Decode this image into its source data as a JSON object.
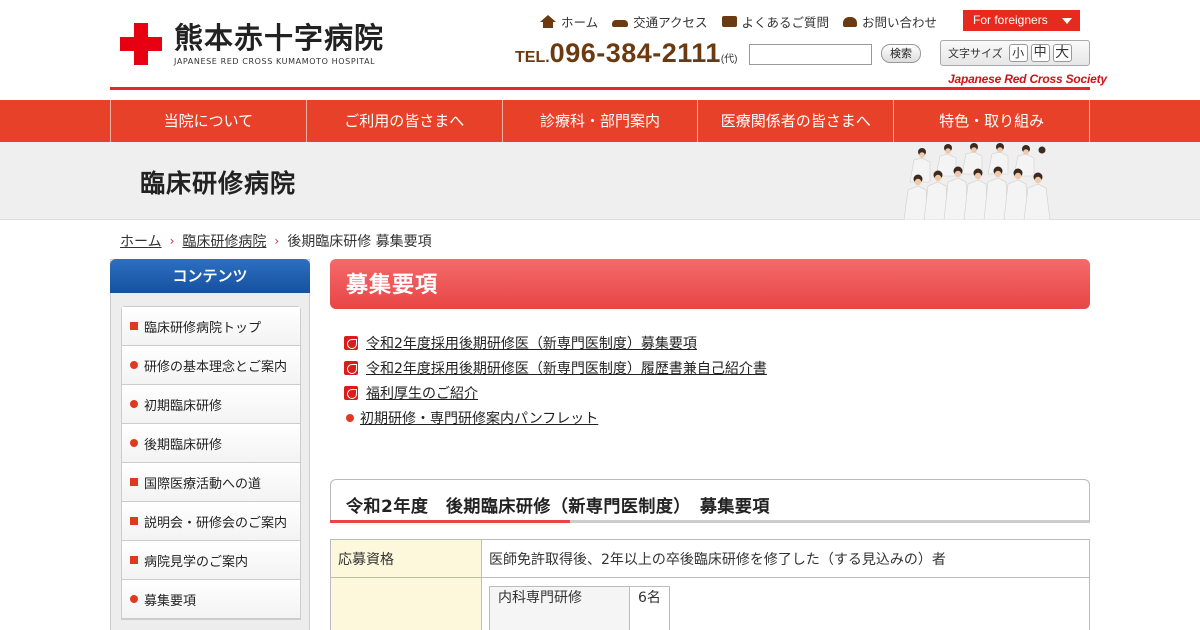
{
  "header": {
    "logo_title": "熊本赤十字病院",
    "logo_sub": "JAPANESE RED CROSS KUMAMOTO HOSPITAL",
    "util_nav": [
      {
        "label": "ホーム",
        "icon": "home-icon"
      },
      {
        "label": "交通アクセス",
        "icon": "car-icon"
      },
      {
        "label": "よくあるご質問",
        "icon": "faq-icon"
      },
      {
        "label": "お問い合わせ",
        "icon": "phone-icon"
      }
    ],
    "foreign_label": "For foreigners",
    "tel_prefix": "TEL.",
    "tel_number": "096-384-2111",
    "tel_suffix": "(代)",
    "search_placeholder": "",
    "search_button": "検索",
    "fontsize_label": "文字サイズ",
    "fontsize_small": "小",
    "fontsize_mid": "中",
    "fontsize_large": "大",
    "society": "Japanese Red Cross Society"
  },
  "gnav": [
    "当院について",
    "ご利用の皆さまへ",
    "診療科・部門案内",
    "医療関係者の皆さまへ",
    "特色・取り組み"
  ],
  "band": {
    "title": "臨床研修病院"
  },
  "breadcrumb": [
    {
      "label": "ホーム"
    },
    {
      "label": "臨床研修病院"
    },
    {
      "label": "後期臨床研修 募集要項"
    }
  ],
  "sidebar": {
    "heading": "コンテンツ",
    "items": [
      {
        "label": "臨床研修病院トップ",
        "mark": "square"
      },
      {
        "label": "研修の基本理念とご案内",
        "mark": "dot"
      },
      {
        "label": "初期臨床研修",
        "mark": "dot"
      },
      {
        "label": "後期臨床研修",
        "mark": "dot"
      },
      {
        "label": "国際医療活動への道",
        "mark": "square"
      },
      {
        "label": "説明会・研修会のご案内",
        "mark": "square"
      },
      {
        "label": "病院見学のご案内",
        "mark": "square"
      },
      {
        "label": "募集要項",
        "mark": "dot"
      }
    ]
  },
  "main": {
    "heading": "募集要項",
    "links": [
      {
        "label": "令和2年度採用後期研修医（新専門医制度）募集要項",
        "icon": "pdf-icon"
      },
      {
        "label": "令和2年度採用後期研修医（新専門医制度）履歴書兼自己紹介書",
        "icon": "pdf-icon"
      },
      {
        "label": "福利厚生のご紹介",
        "icon": "pdf-icon"
      },
      {
        "label": "初期研修・専門研修案内パンフレット",
        "icon": "dot-icon"
      }
    ],
    "section_title": "令和2年度　後期臨床研修（新専門医制度）　募集要項",
    "table": {
      "row1_label": "応募資格",
      "row1_value": "医師免許取得後、2年以上の卒後臨床研修を修了した（する見込みの）者",
      "inner_name": "内科専門研修",
      "inner_count": "6名"
    }
  },
  "colors": {
    "brand_red": "#e8412a",
    "sidebar_blue": "#1551a0",
    "heading_red": "#e84545"
  }
}
